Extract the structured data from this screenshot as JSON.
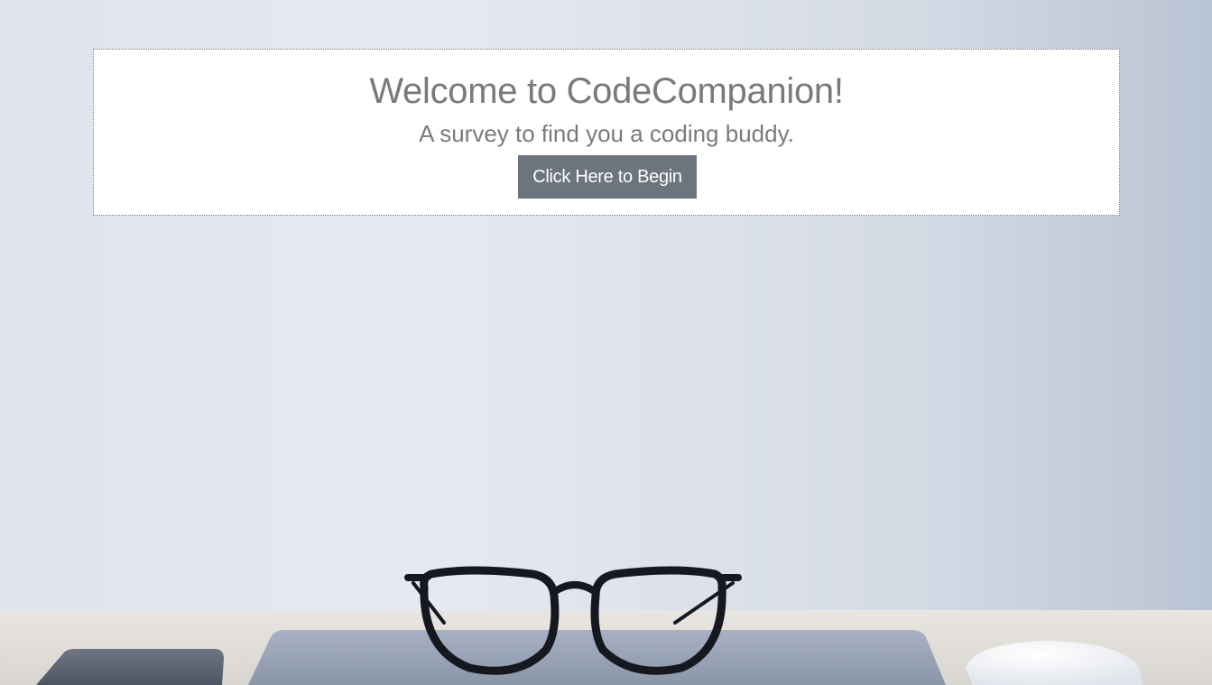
{
  "jumbotron": {
    "title": "Welcome to CodeCompanion!",
    "subtitle": "A survey to find you a coding buddy.",
    "button_label": "Click Here to Begin"
  },
  "colors": {
    "button_bg": "#6c757d",
    "text_gray": "#7a7a7a",
    "panel_bg": "#ffffff"
  }
}
